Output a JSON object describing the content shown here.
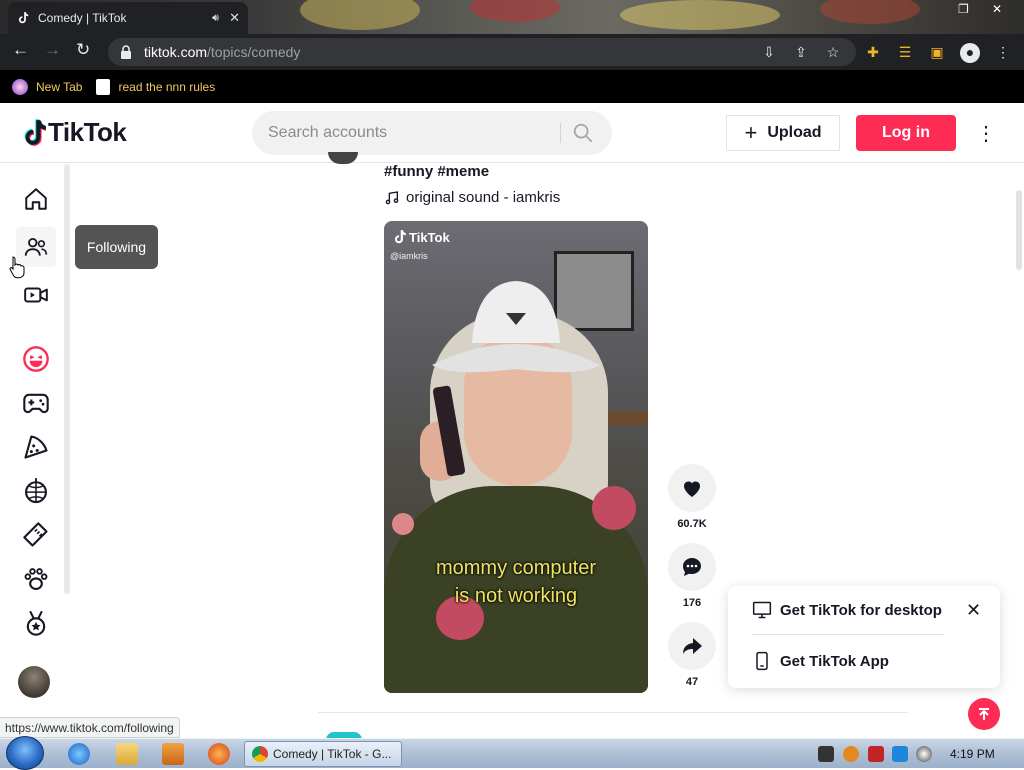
{
  "browser": {
    "tab_title": "Comedy | TikTok",
    "url_host": "tiktok.com",
    "url_path": "/topics/comedy",
    "bookmarks": [
      {
        "label": "New Tab"
      },
      {
        "label": "read the nnn rules"
      }
    ],
    "status_url": "https://www.tiktok.com/following"
  },
  "header": {
    "logo_text": "TikTok",
    "search_placeholder": "Search accounts",
    "upload_label": "Upload",
    "login_label": "Log in"
  },
  "sidebar": {
    "tooltip": "Following"
  },
  "post": {
    "hashtags": "#funny #meme",
    "sound": "original sound - iamkris",
    "watermark_logo": "TikTok",
    "watermark_user": "@iamkris",
    "caption_line1": "mommy computer",
    "caption_line2": "is not working",
    "likes": "60.7K",
    "comments": "176",
    "shares": "47"
  },
  "get_app": {
    "desktop_label": "Get TikTok for desktop",
    "app_label": "Get TikTok App"
  },
  "taskbar": {
    "chrome_task_label": "Comedy | TikTok - G...",
    "clock": "4:19 PM"
  },
  "colors": {
    "brand": "#fe2c55",
    "text": "#161823"
  }
}
